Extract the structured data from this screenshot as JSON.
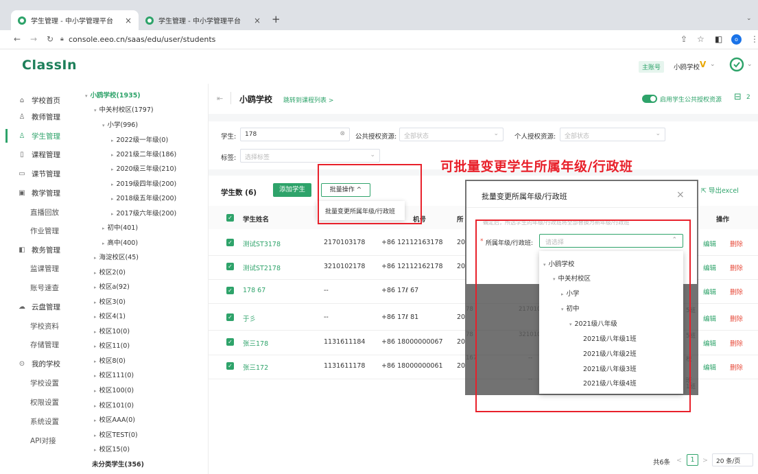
{
  "browser": {
    "tabs": [
      {
        "label": "学生管理 - 中小学管理平台",
        "close": "×"
      },
      {
        "label": "学生管理 - 中小学管理平台",
        "close": "×"
      }
    ],
    "new_tab": "+",
    "url": "console.eeo.cn/saas/edu/user/students",
    "profile_initial": "o"
  },
  "header": {
    "logo": "ClassIn",
    "admin_badge": "主账号",
    "school": "小鸥学校",
    "vip": "V"
  },
  "sidebar": {
    "items": [
      {
        "label": "学校首页",
        "icon": "home-icon"
      },
      {
        "label": "教师管理",
        "icon": "teacher-icon"
      },
      {
        "label": "学生管理",
        "icon": "student-icon",
        "active": true
      },
      {
        "label": "课程管理",
        "icon": "course-icon"
      },
      {
        "label": "课节管理",
        "icon": "lesson-icon"
      },
      {
        "label": "教学管理",
        "icon": "teaching-icon"
      },
      {
        "label": "直播回放",
        "sub": true
      },
      {
        "label": "作业管理",
        "sub": true
      },
      {
        "label": "教务管理",
        "icon": "affairs-icon"
      },
      {
        "label": "监课管理",
        "sub": true
      },
      {
        "label": "账号速查",
        "sub": true
      },
      {
        "label": "云盘管理",
        "icon": "cloud-icon"
      },
      {
        "label": "学校资料",
        "sub": true
      },
      {
        "label": "存储管理",
        "sub": true
      },
      {
        "label": "我的学校",
        "icon": "school-icon"
      },
      {
        "label": "学校设置",
        "sub": true
      },
      {
        "label": "权限设置",
        "sub": true
      },
      {
        "label": "系统设置",
        "sub": true
      },
      {
        "label": "API对接",
        "sub": true
      }
    ]
  },
  "tree": {
    "nodes": [
      {
        "label": "小鸥学校(1935)",
        "arrow": "▾"
      },
      {
        "label": "中关村校区(1797)",
        "arrow": "▾"
      },
      {
        "label": "小学(996)",
        "arrow": "▾"
      },
      {
        "label": "2022级一年级(0)",
        "arrow": "▸"
      },
      {
        "label": "2021级二年级(186)",
        "arrow": "▸"
      },
      {
        "label": "2020级三年级(210)",
        "arrow": "▸"
      },
      {
        "label": "2019级四年级(200)",
        "arrow": "▸"
      },
      {
        "label": "2018级五年级(200)",
        "arrow": "▸"
      },
      {
        "label": "2017级六年级(200)",
        "arrow": "▸"
      },
      {
        "label": "初中(401)",
        "arrow": "▸"
      },
      {
        "label": "高中(400)",
        "arrow": "▸"
      },
      {
        "label": "海淀校区(45)",
        "arrow": "▸"
      },
      {
        "label": "校区2(0)",
        "arrow": "▸"
      },
      {
        "label": "校区a(92)",
        "arrow": "▸"
      },
      {
        "label": "校区3(0)",
        "arrow": "▸"
      },
      {
        "label": "校区4(1)",
        "arrow": "▸"
      },
      {
        "label": "校区10(0)",
        "arrow": "▸"
      },
      {
        "label": "校区11(0)",
        "arrow": "▸"
      },
      {
        "label": "校区8(0)",
        "arrow": "▸"
      },
      {
        "label": "校区111(0)",
        "arrow": "▸"
      },
      {
        "label": "校区100(0)",
        "arrow": "▸"
      },
      {
        "label": "校区101(0)",
        "arrow": "▸"
      },
      {
        "label": "校区AAA(0)",
        "arrow": "▸"
      },
      {
        "label": "校区TEST(0)",
        "arrow": "▸"
      },
      {
        "label": "校区15(0)",
        "arrow": "▸"
      },
      {
        "label": "未分类学生(356)",
        "arrow": ""
      }
    ]
  },
  "main": {
    "back": "⇤",
    "school_title": "小鸥学校",
    "jump_link": "跳转到课程列表 >",
    "toggle_label": "启用学生公共授权资源",
    "count_badge": "2",
    "filters": {
      "student_label": "学生:",
      "student_value": "178",
      "public_label": "公共授权资源:",
      "public_placeholder": "全部状态",
      "personal_label": "个人授权资源:",
      "personal_placeholder": "全部状态",
      "tag_label": "标签:",
      "tag_placeholder": "选择标签"
    },
    "student_count": "学生数 (6)",
    "add_button": "添加学生",
    "bulk_button": "批量操作 ^",
    "bulk_menu_item": "批量变更所属年级/行政班",
    "export": "导出excel",
    "table": {
      "headers": [
        "学生姓名",
        "",
        "机号",
        "所",
        "操作"
      ],
      "rows": [
        {
          "name": "测试ST3178",
          "id": "2170103178",
          "phone": "+86 12112163178",
          "col4": "20",
          "edit": "编辑",
          "del": "删除"
        },
        {
          "name": "测试ST2178",
          "id": "3210102178",
          "phone": "+86 12112162178",
          "col4": "20",
          "edit": "编辑",
          "del": "删除"
        },
        {
          "name": "178          67",
          "id": "--",
          "phone": "+86 17ℓ       67",
          "col4": "",
          "edit": "编辑",
          "del": "删除"
        },
        {
          "name": "于彡",
          "id": "--",
          "phone": "+86 17ℓ       81",
          "col4": "20",
          "edit": "编辑",
          "del": "删除"
        },
        {
          "name": "张三178",
          "id": "1131611184",
          "phone": "+86 18000000067",
          "col4": "20",
          "edit": "编辑",
          "del": "删除"
        },
        {
          "name": "张三172",
          "id": "1131611178",
          "phone": "+86 18000000061",
          "col4": "20",
          "edit": "编辑",
          "del": "删除"
        }
      ]
    },
    "pagination": {
      "total": "共6条",
      "prev": "<",
      "page": "1",
      "next": ">",
      "size": "20 条/页"
    }
  },
  "dialog": {
    "title": "批量变更所属年级/行政班",
    "close": "×",
    "note": "确定后，所选学生的年级/行政班将全部替换为新年级/行政班",
    "field_label": "所属年级/行政班:",
    "required": "*",
    "placeholder": "请选择",
    "tree": [
      {
        "label": "小鸥学校",
        "arrow": "▾"
      },
      {
        "label": "中关村校区",
        "arrow": "▾"
      },
      {
        "label": "小学",
        "arrow": "▸"
      },
      {
        "label": "初中",
        "arrow": "▾"
      },
      {
        "label": "2021级八年级",
        "arrow": "▾"
      },
      {
        "label": "2021级八年级1班",
        "arrow": ""
      },
      {
        "label": "2021级八年级2班",
        "arrow": ""
      },
      {
        "label": "2021级八年级3班",
        "arrow": ""
      },
      {
        "label": "2021级八年级4班",
        "arrow": ""
      }
    ],
    "behind_cells": [
      "78",
      "217010",
      "5班",
      "78",
      "321010",
      "5班",
      "167",
      "--",
      "校",
      "--",
      "班",
      "1班",
      "查看1班"
    ]
  },
  "annotation": {
    "title": "可批量变更学生所属年级/行政班",
    "color": "#e8202a"
  },
  "colors": {
    "accent": "#2ea36a",
    "danger": "#e74c3c"
  }
}
